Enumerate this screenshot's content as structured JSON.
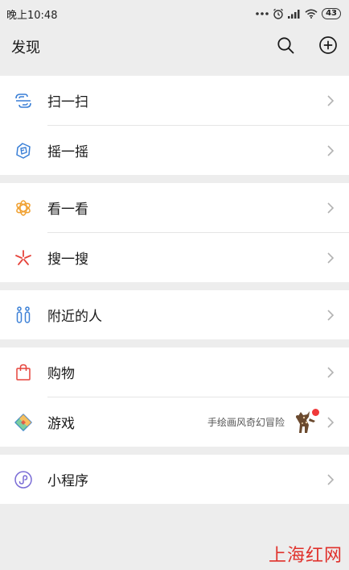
{
  "status_bar": {
    "time": "晚上10:48",
    "battery": "43"
  },
  "header": {
    "title": "发现"
  },
  "groups": [
    {
      "items": [
        {
          "label": "扫一扫",
          "icon": "scan-icon"
        },
        {
          "label": "摇一摇",
          "icon": "shake-icon"
        }
      ]
    },
    {
      "items": [
        {
          "label": "看一看",
          "icon": "top-stories-icon"
        },
        {
          "label": "搜一搜",
          "icon": "search-star-icon"
        }
      ]
    },
    {
      "items": [
        {
          "label": "附近的人",
          "icon": "people-nearby-icon"
        }
      ]
    },
    {
      "items": [
        {
          "label": "购物",
          "icon": "shopping-bag-icon"
        },
        {
          "label": "游戏",
          "icon": "games-icon",
          "extra": "手绘画风奇幻冒险"
        }
      ]
    },
    {
      "items": [
        {
          "label": "小程序",
          "icon": "mini-programs-icon"
        }
      ]
    }
  ],
  "watermark": "上海红网",
  "colors": {
    "background": "#ededed",
    "scan": "#3a7fd6",
    "shake": "#3a7fd6",
    "top_stories": "#f0a030",
    "search": "#e6443c",
    "nearby": "#3a7fd6",
    "shopping": "#e6443c",
    "badge": "#f0393a",
    "mini_programs": "#7a6cd6"
  }
}
